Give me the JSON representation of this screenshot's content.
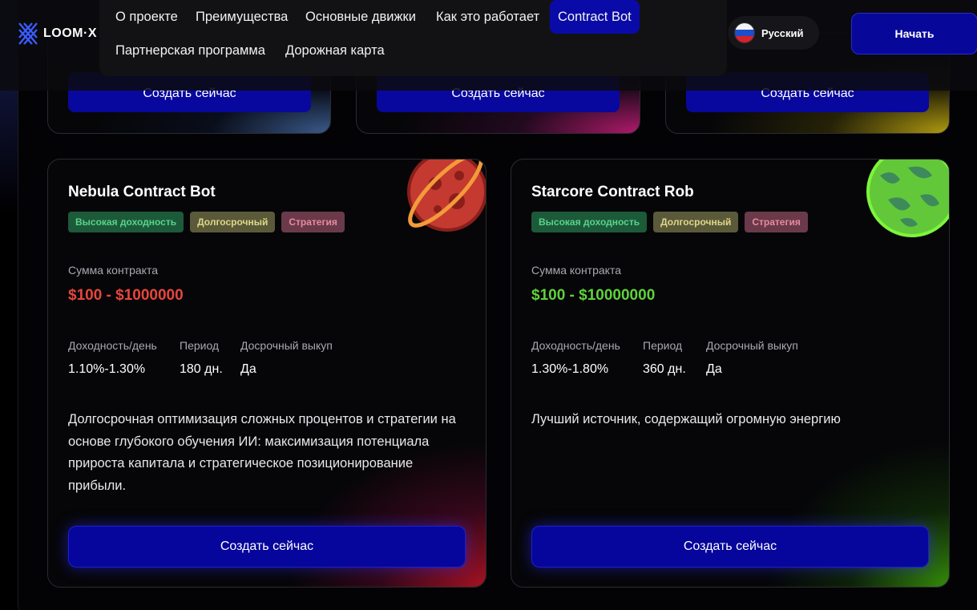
{
  "header": {
    "logo_text": "LOOM·X",
    "nav": [
      {
        "label": "О проекте"
      },
      {
        "label": "Преимущества"
      },
      {
        "label": "Основные движки"
      },
      {
        "label": "Как это работает"
      },
      {
        "label": "Contract Bot",
        "active": true
      },
      {
        "label": "Партнерская программа"
      },
      {
        "label": "Дорожная карта"
      }
    ],
    "language": "Русский",
    "start_button": "Начать"
  },
  "top_cards": [
    {
      "button": "Создать сейчас"
    },
    {
      "button": "Создать сейчас"
    },
    {
      "button": "Создать сейчас"
    }
  ],
  "cards": [
    {
      "title": "Nebula Contract Bot",
      "tags": [
        "Высокая доходность",
        "Долгосрочный",
        "Стратегия"
      ],
      "amount_label": "Сумма контракта",
      "amount": "$100 - $1000000",
      "amount_color": "#e8453c",
      "yield_label": "Доходность/день",
      "yield": "1.10%-1.30%",
      "period_label": "Период",
      "period": "180 дн.",
      "buyout_label": "Досрочный выкуп",
      "buyout": "Да",
      "description": "Долгосрочная оптимизация сложных процентов и стратегии на основе глубокого обучения ИИ: максимизация потенциала прироста капитала и стратегическое позиционирование прибыли.",
      "button": "Создать сейчас",
      "planet_icon": "red-ringed-planet-icon"
    },
    {
      "title": "Starcore Contract Rob",
      "tags": [
        "Высокая доходность",
        "Долгосрочный",
        "Стратегия"
      ],
      "amount_label": "Сумма контракта",
      "amount": "$100 - $10000000",
      "amount_color": "#5fd23a",
      "yield_label": "Доходность/день",
      "yield": "1.30%-1.80%",
      "period_label": "Период",
      "period": "360 дн.",
      "buyout_label": "Досрочный выкуп",
      "buyout": "Да",
      "description": "Лучший источник, содержащий огромную энергию",
      "button": "Создать сейчас",
      "planet_icon": "green-planet-icon"
    }
  ]
}
